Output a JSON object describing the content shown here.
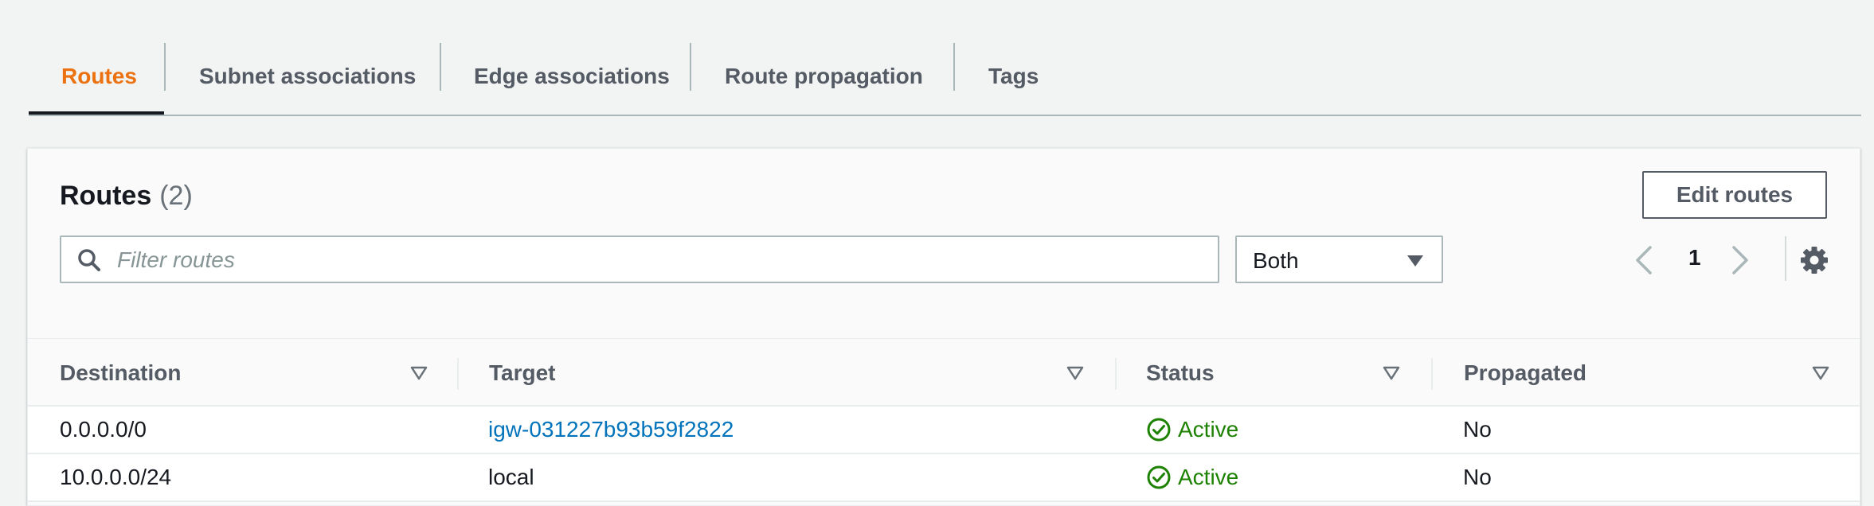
{
  "tabs": [
    {
      "label": "Routes",
      "active": true
    },
    {
      "label": "Subnet associations",
      "active": false
    },
    {
      "label": "Edge associations",
      "active": false
    },
    {
      "label": "Route propagation",
      "active": false
    },
    {
      "label": "Tags",
      "active": false
    }
  ],
  "panel": {
    "title": "Routes",
    "count": "(2)",
    "edit_button": "Edit routes"
  },
  "filter": {
    "placeholder": "Filter routes",
    "value": ""
  },
  "select": {
    "value": "Both"
  },
  "pagination": {
    "page": "1"
  },
  "table": {
    "columns": [
      "Destination",
      "Target",
      "Status",
      "Propagated"
    ],
    "rows": [
      {
        "destination": "0.0.0.0/0",
        "target": "igw-031227b93b59f2822",
        "target_is_link": true,
        "status": "Active",
        "propagated": "No"
      },
      {
        "destination": "10.0.0.0/24",
        "target": "local",
        "target_is_link": false,
        "status": "Active",
        "propagated": "No"
      }
    ]
  },
  "colors": {
    "active_tab": "#ec7211",
    "link": "#0073bb",
    "status_active": "#1d8102"
  },
  "icons": {
    "search": "search-icon",
    "caret": "caret-down-icon",
    "prev": "chevron-left-icon",
    "next": "chevron-right-icon",
    "settings": "gear-icon",
    "sort": "sort-icon",
    "status": "check-circle-icon"
  }
}
